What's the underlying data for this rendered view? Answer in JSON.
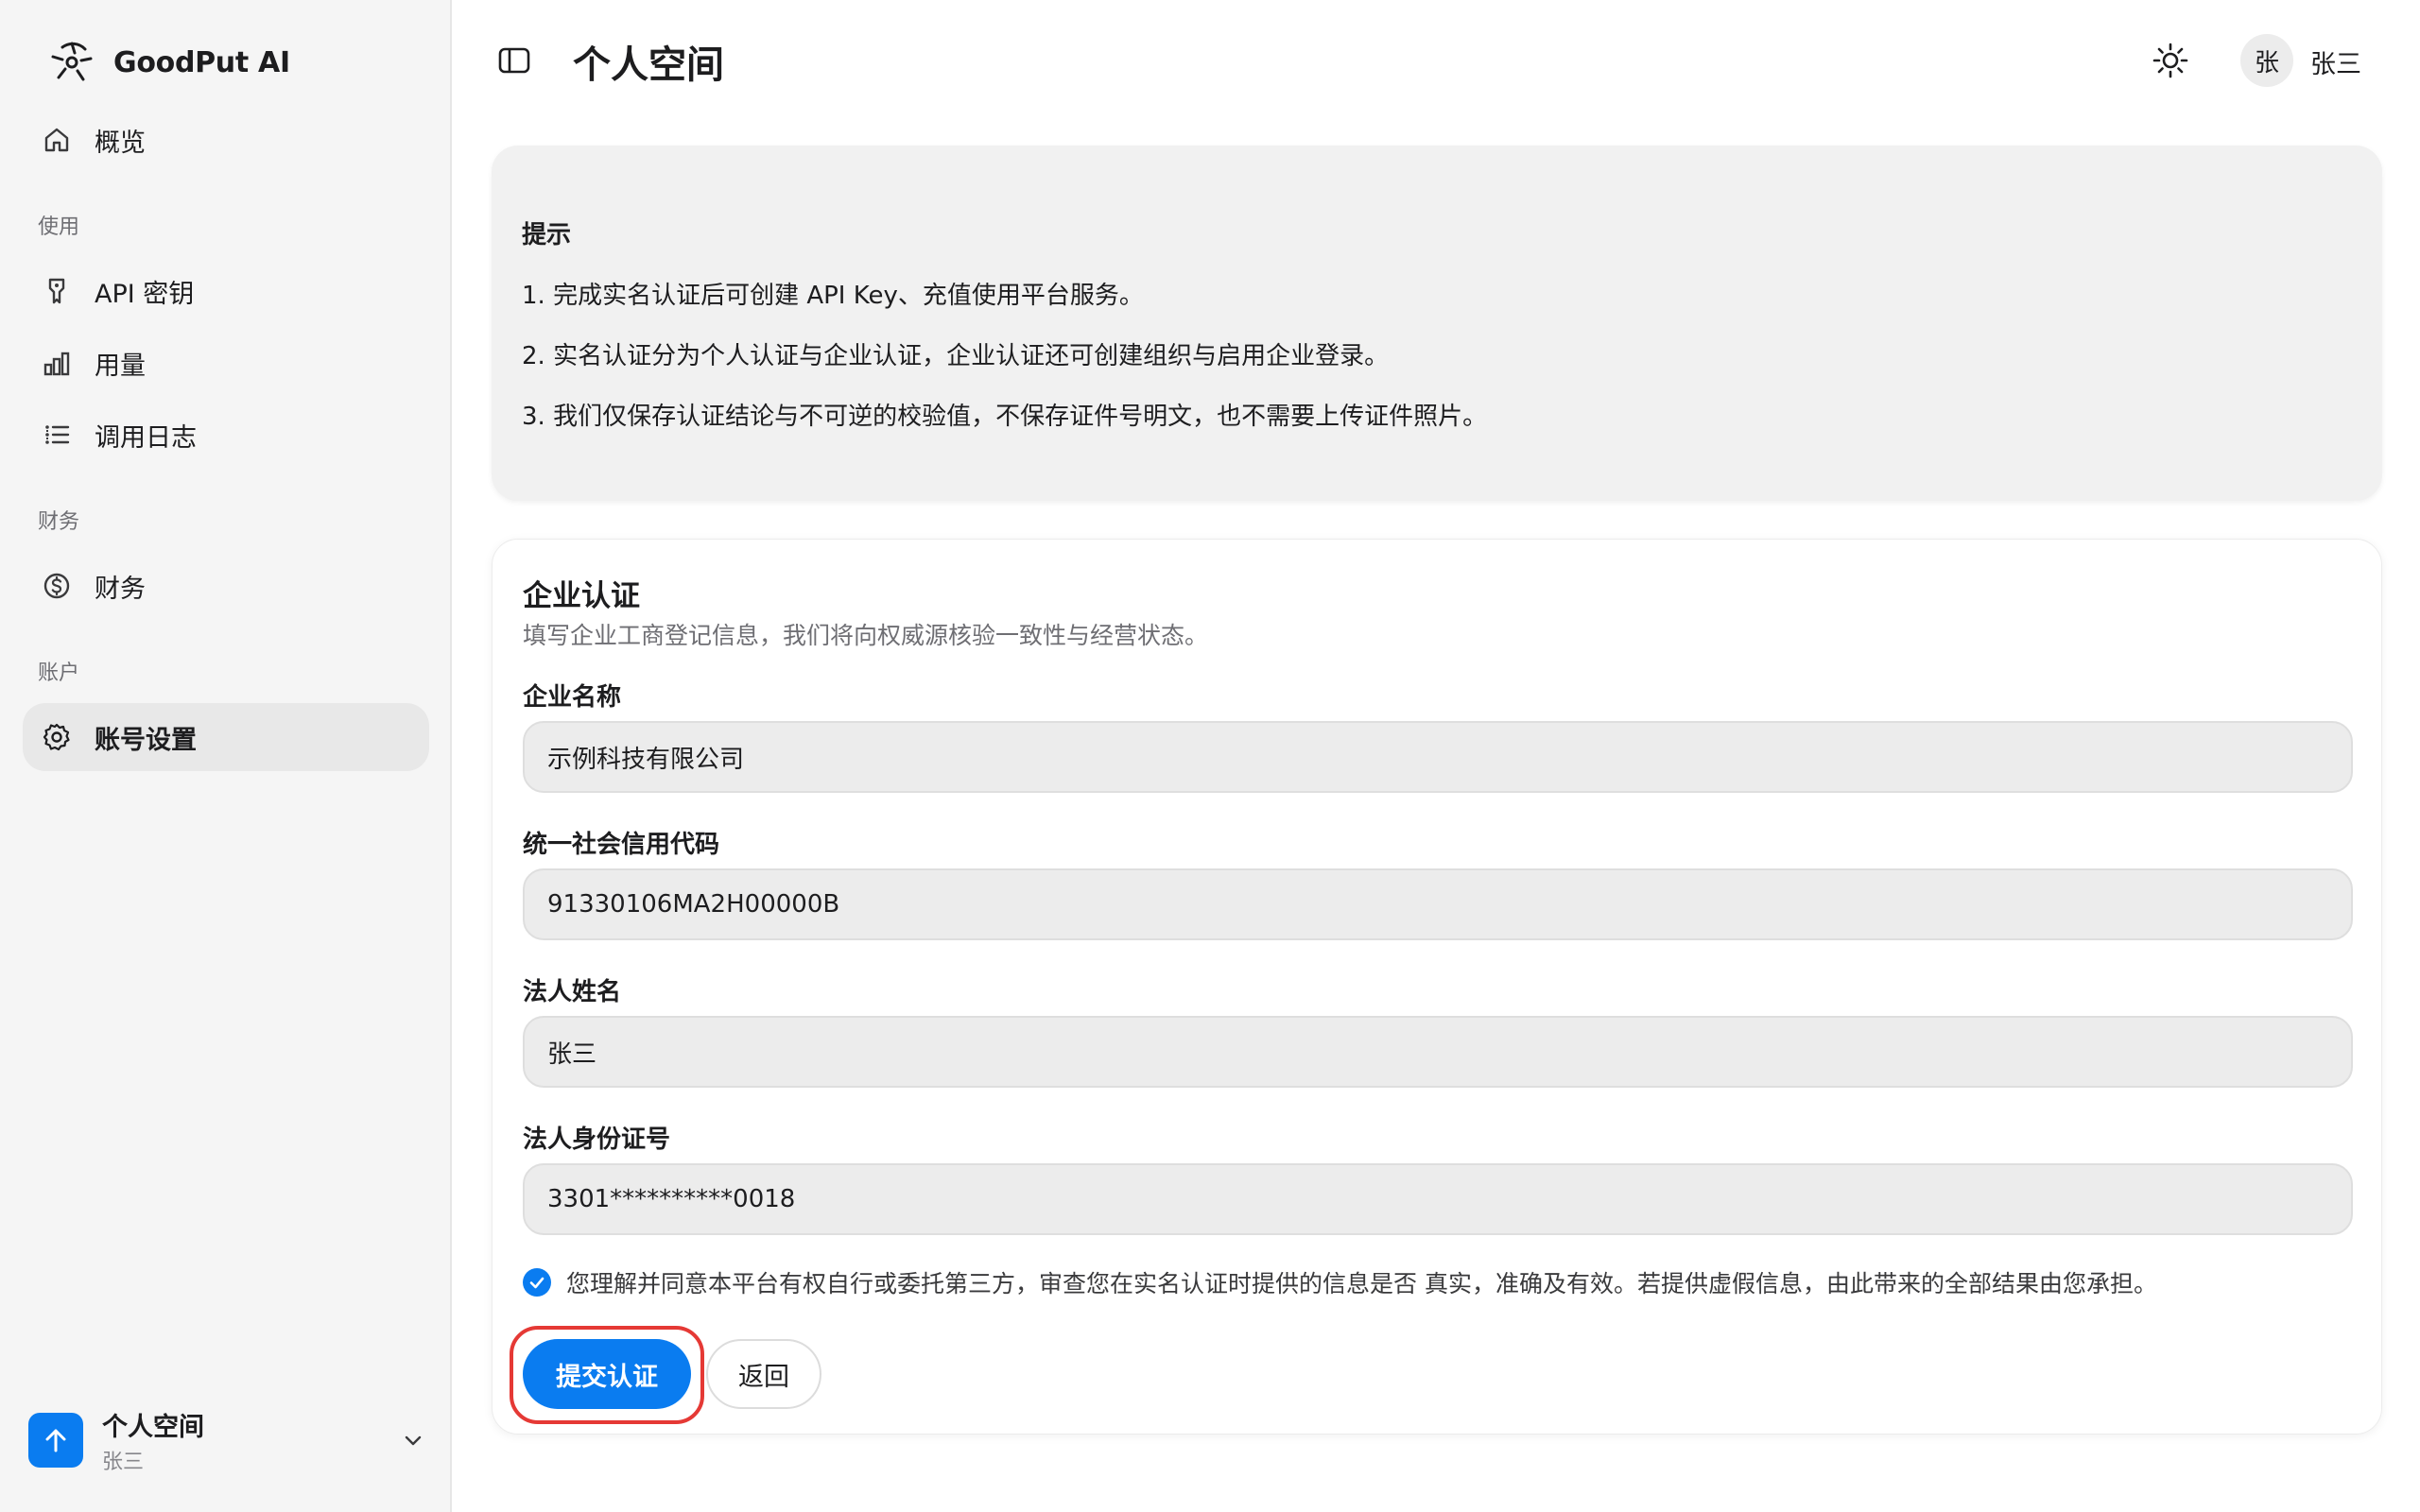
{
  "brand": {
    "name": "GoodPut AI"
  },
  "sidebar": {
    "overview": "概览",
    "sections": {
      "use": "使用",
      "finance": "财务",
      "account": "账户"
    },
    "items": {
      "api_keys": "API 密钥",
      "usage": "用量",
      "logs": "调用日志",
      "finance": "财务",
      "settings": "账号设置"
    },
    "active": "settings",
    "workspace": {
      "name": "个人空间",
      "user": "张三"
    }
  },
  "header": {
    "title": "个人空间",
    "avatar_initial": "张",
    "user_name": "张三"
  },
  "notice": {
    "title": "提示",
    "lines": [
      "1. 完成实名认证后可创建 API Key、充值使用平台服务。",
      "2. 实名认证分为个人认证与企业认证，企业认证还可创建组织与启用企业登录。",
      "3. 我们仅保存认证结论与不可逆的校验值，不保存证件号明文，也不需要上传证件照片。"
    ]
  },
  "form": {
    "title": "企业认证",
    "description": "填写企业工商登记信息，我们将向权威源核验一致性与经营状态。",
    "fields": {
      "company_name": {
        "label": "企业名称",
        "value": "示例科技有限公司"
      },
      "credit_code": {
        "label": "统一社会信用代码",
        "value": "91330106MA2H00000B"
      },
      "legal_name": {
        "label": "法人姓名",
        "value": "张三"
      },
      "legal_id": {
        "label": "法人身份证号",
        "value": "3301**********0018"
      }
    },
    "agreement": "您理解并同意本平台有权自行或委托第三方，审查您在实名认证时提供的信息是否 真实，准确及有效。若提供虚假信息，由此带来的全部结果由您承担。",
    "agreement_checked": true,
    "submit_label": "提交认证",
    "back_label": "返回"
  },
  "colors": {
    "accent": "#0a7cf0",
    "highlight": "#e53935",
    "sidebar_bg": "#f5f5f5",
    "input_bg": "#ececec"
  }
}
